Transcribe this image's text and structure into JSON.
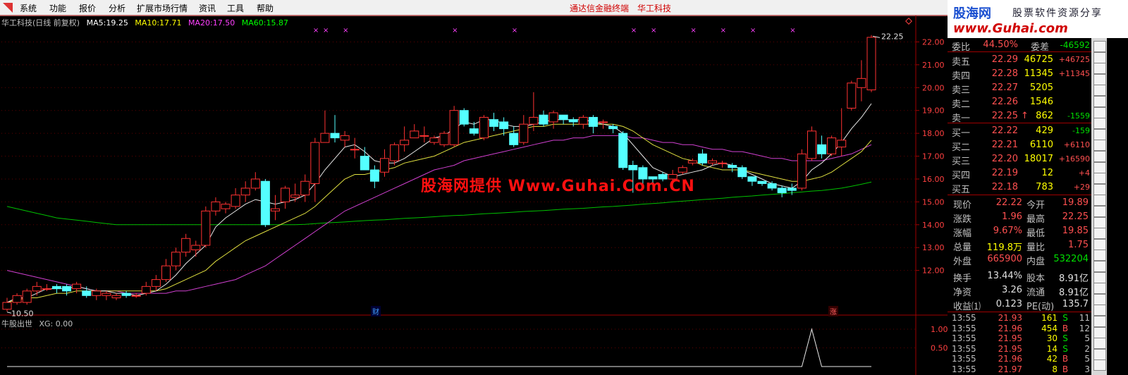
{
  "menu": {
    "items": [
      "系统",
      "功能",
      "报价",
      "分析",
      "扩展市场行情",
      "资讯",
      "工具",
      "帮助"
    ],
    "center_title": [
      "通达信金融终端",
      "华工科技"
    ]
  },
  "legend": {
    "title": "华工科技(日线 前复权)",
    "ma": [
      {
        "label": "MA5:",
        "value": "19.25",
        "color": "#ffffff"
      },
      {
        "label": "MA10:",
        "value": "17.71",
        "color": "#ffff00"
      },
      {
        "label": "MA20:",
        "value": "17.50",
        "color": "#ff40ff"
      },
      {
        "label": "MA60:",
        "value": "15.87",
        "color": "#00ff00"
      }
    ]
  },
  "sub_legend": {
    "name": "牛股出世",
    "xg_label": "XG:",
    "xg_value": "0.00"
  },
  "price_axis": [
    "22.00",
    "21.00",
    "20.00",
    "19.00",
    "18.00",
    "17.00",
    "16.00",
    "15.00",
    "14.00",
    "13.00",
    "12.00"
  ],
  "sub_axis": [
    "1.00",
    "0.50"
  ],
  "annotations": {
    "high_label": "22.25",
    "low_label": "10.50",
    "marker_cai": "财",
    "marker_zhang": "涨"
  },
  "watermark": "股海网提供 Www.Guhai.Com.CN",
  "banner": {
    "brand": "股海网",
    "slogan": "股票软件资源分享",
    "site": "www.Guhai.com"
  },
  "order_book": {
    "ratio_label": "委比",
    "ratio_value": "44.50%",
    "diff_label": "委差",
    "diff_value": "-46592",
    "asks": [
      {
        "label": "卖五",
        "price": "22.29",
        "vol": "46725",
        "chg": "+46725"
      },
      {
        "label": "卖四",
        "price": "22.28",
        "vol": "11345",
        "chg": "+11345"
      },
      {
        "label": "卖三",
        "price": "22.27",
        "vol": "5205",
        "chg": ""
      },
      {
        "label": "卖二",
        "price": "22.26",
        "vol": "1546",
        "chg": ""
      },
      {
        "label": "卖一",
        "price": "22.25",
        "vol": "862",
        "chg": "-1559",
        "arrow": "↑"
      }
    ],
    "bids": [
      {
        "label": "买一",
        "price": "22.22",
        "vol": "429",
        "chg": "-159"
      },
      {
        "label": "买二",
        "price": "22.21",
        "vol": "6110",
        "chg": "+6110"
      },
      {
        "label": "买三",
        "price": "22.20",
        "vol": "18017",
        "chg": "+16590"
      },
      {
        "label": "买四",
        "price": "22.19",
        "vol": "12",
        "chg": "+4"
      },
      {
        "label": "买五",
        "price": "22.18",
        "vol": "783",
        "chg": "+29"
      }
    ]
  },
  "quote": [
    {
      "l1": "现价",
      "v1": "22.22",
      "c1": "red",
      "l2": "今开",
      "v2": "19.89",
      "c2": "red"
    },
    {
      "l1": "涨跌",
      "v1": "1.96",
      "c1": "red",
      "l2": "最高",
      "v2": "22.25",
      "c2": "red"
    },
    {
      "l1": "涨幅",
      "v1": "9.67%",
      "c1": "red",
      "l2": "最低",
      "v2": "19.85",
      "c2": "red"
    },
    {
      "l1": "总量",
      "v1": "119.8万",
      "c1": "yellow",
      "l2": "量比",
      "v2": "1.75",
      "c2": "red"
    },
    {
      "l1": "外盘",
      "v1": "665900",
      "c1": "red",
      "l2": "内盘",
      "v2": "532204",
      "c2": "green"
    },
    {
      "l1": "换手",
      "v1": "13.44%",
      "c1": "white",
      "l2": "股本",
      "v2": "8.91亿",
      "c2": "white"
    },
    {
      "l1": "净资",
      "v1": "3.26",
      "c1": "white",
      "l2": "流通",
      "v2": "8.91亿",
      "c2": "white"
    },
    {
      "l1": "收益⑴",
      "v1": "0.123",
      "c1": "white",
      "l2": "PE(动)",
      "v2": "135.7",
      "c2": "white"
    }
  ],
  "ticks": [
    {
      "time": "13:55",
      "price": "21.93",
      "vol": "161",
      "side": "S",
      "count": "11"
    },
    {
      "time": "13:55",
      "price": "21.96",
      "vol": "454",
      "side": "B",
      "count": "12"
    },
    {
      "time": "13:55",
      "price": "21.95",
      "vol": "30",
      "side": "S",
      "count": "5"
    },
    {
      "time": "13:55",
      "price": "21.95",
      "vol": "14",
      "side": "S",
      "count": "2"
    },
    {
      "time": "13:55",
      "price": "21.96",
      "vol": "42",
      "side": "B",
      "count": "5"
    },
    {
      "time": "13:55",
      "price": "21.97",
      "vol": "8",
      "side": "B",
      "count": "3"
    }
  ],
  "chart_data": {
    "type": "candlestick",
    "ylim": [
      10.2,
      22.6
    ],
    "candles": [
      [
        10.3,
        10.6,
        10.2,
        10.8
      ],
      [
        10.6,
        10.9,
        10.5,
        11.0
      ],
      [
        10.6,
        11.1,
        10.5,
        11.2
      ],
      [
        11.1,
        11.3,
        10.9,
        11.5
      ],
      [
        11.2,
        11.2,
        11.1,
        11.4
      ],
      [
        11.3,
        11.2,
        11.0,
        11.4
      ],
      [
        11.3,
        11.1,
        10.9,
        11.4
      ],
      [
        11.2,
        11.4,
        11.0,
        11.5
      ],
      [
        11.1,
        10.9,
        10.8,
        11.3
      ],
      [
        10.9,
        11.1,
        10.7,
        11.2
      ],
      [
        10.9,
        11.0,
        10.7,
        11.1
      ],
      [
        10.8,
        10.9,
        10.7,
        11.0
      ],
      [
        11.0,
        10.9,
        10.8,
        11.1
      ],
      [
        10.9,
        10.9,
        10.8,
        11.0
      ],
      [
        11.0,
        11.3,
        10.9,
        11.5
      ],
      [
        11.3,
        11.6,
        11.1,
        11.8
      ],
      [
        11.6,
        12.2,
        11.5,
        12.5
      ],
      [
        12.2,
        12.8,
        12.0,
        13.0
      ],
      [
        12.8,
        13.4,
        12.6,
        13.6
      ],
      [
        12.9,
        13.1,
        12.6,
        13.3
      ],
      [
        13.1,
        14.6,
        13.0,
        14.8
      ],
      [
        14.6,
        15.0,
        14.4,
        15.2
      ],
      [
        14.7,
        14.9,
        14.5,
        15.0
      ],
      [
        14.8,
        15.3,
        14.7,
        15.6
      ],
      [
        15.3,
        15.6,
        15.0,
        15.9
      ],
      [
        15.6,
        16.0,
        15.5,
        16.3
      ],
      [
        15.9,
        14.0,
        13.9,
        16.0
      ],
      [
        14.6,
        14.7,
        14.2,
        15.3
      ],
      [
        15.0,
        15.6,
        14.7,
        15.7
      ],
      [
        15.2,
        15.3,
        15.0,
        15.8
      ],
      [
        15.3,
        15.9,
        15.0,
        16.2
      ],
      [
        15.8,
        17.6,
        15.0,
        17.8
      ],
      [
        17.6,
        18.0,
        17.6,
        19.0
      ],
      [
        18.0,
        17.8,
        17.6,
        18.8
      ],
      [
        17.7,
        17.9,
        17.4,
        18.1
      ],
      [
        17.3,
        17.3,
        16.9,
        17.8
      ],
      [
        17.0,
        16.4,
        16.4,
        17.4
      ],
      [
        16.4,
        15.9,
        15.6,
        16.6
      ],
      [
        16.3,
        16.9,
        16.1,
        17.3
      ],
      [
        16.8,
        17.5,
        16.6,
        17.6
      ],
      [
        17.5,
        17.7,
        17.2,
        18.3
      ],
      [
        17.8,
        18.1,
        17.8,
        18.4
      ],
      [
        17.9,
        17.9,
        17.6,
        18.3
      ],
      [
        17.6,
        17.8,
        17.5,
        17.9
      ],
      [
        17.5,
        18.0,
        17.4,
        18.1
      ],
      [
        17.5,
        19.0,
        17.4,
        19.2
      ],
      [
        19.0,
        18.4,
        18.3,
        19.1
      ],
      [
        18.2,
        18.0,
        17.9,
        18.5
      ],
      [
        17.8,
        18.7,
        17.7,
        18.8
      ],
      [
        18.6,
        18.3,
        18.1,
        18.9
      ],
      [
        18.5,
        18.2,
        17.9,
        18.7
      ],
      [
        18.0,
        17.5,
        17.4,
        18.3
      ],
      [
        17.6,
        18.4,
        17.5,
        18.8
      ],
      [
        18.4,
        18.7,
        18.1,
        19.8
      ],
      [
        18.8,
        18.4,
        18.3,
        19.0
      ],
      [
        18.5,
        18.9,
        18.2,
        19.0
      ],
      [
        18.8,
        18.6,
        18.4,
        18.8
      ],
      [
        18.6,
        18.5,
        18.3,
        18.7
      ],
      [
        18.4,
        18.7,
        18.2,
        18.8
      ],
      [
        18.7,
        18.3,
        18.0,
        18.8
      ],
      [
        18.5,
        18.5,
        18.2,
        18.6
      ],
      [
        18.3,
        18.2,
        18.0,
        18.4
      ],
      [
        18.0,
        16.5,
        16.4,
        18.1
      ],
      [
        16.6,
        16.4,
        15.4,
        16.8
      ],
      [
        16.5,
        16.0,
        15.6,
        16.6
      ],
      [
        16.1,
        16.0,
        15.8,
        16.1
      ],
      [
        16.2,
        16.0,
        15.9,
        16.3
      ],
      [
        16.0,
        16.2,
        15.8,
        16.4
      ],
      [
        16.3,
        16.5,
        16.2,
        16.6
      ],
      [
        16.7,
        16.8,
        16.6,
        16.9
      ],
      [
        17.1,
        16.7,
        16.6,
        17.3
      ],
      [
        16.7,
        16.8,
        16.6,
        16.9
      ],
      [
        16.7,
        16.7,
        16.5,
        16.8
      ],
      [
        16.6,
        16.5,
        16.3,
        16.7
      ],
      [
        16.5,
        16.1,
        16.0,
        16.6
      ],
      [
        16.1,
        15.9,
        15.7,
        16.1
      ],
      [
        15.9,
        15.8,
        15.7,
        15.9
      ],
      [
        15.8,
        15.6,
        15.5,
        15.9
      ],
      [
        15.6,
        15.4,
        15.2,
        15.7
      ],
      [
        15.6,
        15.5,
        15.3,
        15.8
      ],
      [
        15.6,
        17.1,
        15.5,
        17.3
      ],
      [
        16.9,
        18.1,
        16.8,
        18.3
      ],
      [
        17.5,
        17.1,
        16.9,
        17.9
      ],
      [
        17.1,
        17.8,
        17.0,
        17.9
      ],
      [
        17.4,
        17.7,
        17.0,
        19.1
      ],
      [
        19.1,
        20.2,
        19.0,
        20.3
      ],
      [
        20.0,
        20.4,
        19.4,
        21.2
      ],
      [
        19.9,
        22.2,
        19.8,
        22.3
      ]
    ],
    "ma5": [
      10.6,
      10.8,
      10.8,
      11.0,
      11.2,
      11.2,
      11.2,
      11.3,
      11.2,
      11.1,
      11.1,
      11.0,
      11.0,
      10.9,
      11.0,
      11.1,
      11.4,
      11.8,
      12.3,
      12.7,
      13.1,
      13.9,
      14.3,
      14.6,
      14.9,
      15.1,
      15.0,
      14.9,
      15.0,
      15.1,
      15.3,
      15.8,
      16.4,
      16.9,
      17.4,
      17.5,
      17.2,
      16.8,
      16.7,
      16.7,
      16.9,
      17.2,
      17.5,
      17.8,
      17.9,
      18.2,
      18.5,
      18.4,
      18.6,
      18.6,
      18.4,
      18.3,
      18.3,
      18.4,
      18.5,
      18.6,
      18.6,
      18.6,
      18.6,
      18.5,
      18.4,
      18.3,
      18.0,
      17.5,
      17.0,
      16.5,
      16.3,
      16.1,
      16.2,
      16.3,
      16.4,
      16.6,
      16.7,
      16.6,
      16.4,
      16.2,
      16.0,
      15.8,
      15.7,
      15.6,
      15.9,
      16.4,
      16.7,
      17.1,
      17.6,
      18.2,
      18.7,
      19.3
    ],
    "ma10": [
      10.6,
      10.7,
      10.8,
      10.8,
      10.9,
      11.0,
      11.0,
      11.1,
      11.1,
      11.1,
      11.1,
      11.1,
      11.1,
      11.1,
      11.1,
      11.1,
      11.2,
      11.4,
      11.6,
      11.8,
      12.0,
      12.4,
      12.7,
      13.0,
      13.3,
      13.5,
      13.7,
      13.9,
      14.1,
      14.3,
      14.5,
      14.8,
      15.2,
      15.6,
      16.0,
      16.2,
      16.2,
      16.3,
      16.4,
      16.5,
      16.7,
      16.8,
      16.9,
      17.0,
      17.2,
      17.4,
      17.6,
      17.7,
      17.8,
      17.9,
      18.0,
      18.1,
      18.2,
      18.3,
      18.3,
      18.4,
      18.4,
      18.4,
      18.4,
      18.4,
      18.4,
      18.4,
      18.3,
      18.1,
      17.8,
      17.5,
      17.3,
      17.1,
      16.9,
      16.8,
      16.6,
      16.5,
      16.4,
      16.4,
      16.4,
      16.3,
      16.2,
      16.1,
      16.0,
      15.9,
      15.9,
      16.0,
      16.1,
      16.3,
      16.6,
      16.9,
      17.2,
      17.7
    ],
    "ma20": [
      12.0,
      11.9,
      11.8,
      11.7,
      11.6,
      11.5,
      11.4,
      11.3,
      11.2,
      11.1,
      11.1,
      11.1,
      11.0,
      11.0,
      11.0,
      11.0,
      11.0,
      11.1,
      11.1,
      11.2,
      11.3,
      11.4,
      11.5,
      11.6,
      11.8,
      12.0,
      12.2,
      12.5,
      12.8,
      13.1,
      13.4,
      13.7,
      14.0,
      14.3,
      14.6,
      14.8,
      15.0,
      15.2,
      15.4,
      15.6,
      15.8,
      16.0,
      16.2,
      16.4,
      16.5,
      16.6,
      16.8,
      16.9,
      17.0,
      17.1,
      17.2,
      17.3,
      17.4,
      17.5,
      17.6,
      17.7,
      17.7,
      17.8,
      17.8,
      17.9,
      17.9,
      17.9,
      17.9,
      17.8,
      17.8,
      17.7,
      17.6,
      17.6,
      17.5,
      17.5,
      17.4,
      17.3,
      17.3,
      17.2,
      17.2,
      17.1,
      17.0,
      16.9,
      16.9,
      16.8,
      16.8,
      16.8,
      16.8,
      16.9,
      17.0,
      17.1,
      17.3,
      17.5
    ],
    "ma60": [
      14.8,
      14.7,
      14.6,
      14.5,
      14.4,
      14.3,
      14.25,
      14.2,
      14.15,
      14.1,
      14.05,
      14.0,
      14.0,
      14.0,
      14.0,
      14.0,
      14.0,
      14.0,
      14.0,
      14.0,
      14.0,
      14.0,
      14.0,
      14.0,
      14.0,
      14.0,
      14.0,
      14.0,
      14.0,
      14.0,
      14.02,
      14.05,
      14.08,
      14.1,
      14.12,
      14.15,
      14.18,
      14.2,
      14.22,
      14.25,
      14.28,
      14.3,
      14.32,
      14.35,
      14.38,
      14.4,
      14.42,
      14.45,
      14.48,
      14.5,
      14.52,
      14.55,
      14.58,
      14.6,
      14.62,
      14.65,
      14.68,
      14.7,
      14.72,
      14.75,
      14.78,
      14.8,
      14.83,
      14.86,
      14.9,
      14.93,
      14.96,
      15.0,
      15.03,
      15.06,
      15.1,
      15.13,
      15.16,
      15.2,
      15.23,
      15.26,
      15.3,
      15.33,
      15.36,
      15.4,
      15.43,
      15.47,
      15.5,
      15.55,
      15.6,
      15.68,
      15.77,
      15.87
    ],
    "xg": [
      0,
      0,
      0,
      0,
      0,
      0,
      0,
      0,
      0,
      0,
      0,
      0,
      0,
      0,
      0,
      0,
      0,
      0,
      0,
      0,
      0,
      0,
      0,
      0,
      0,
      0,
      0,
      0,
      0,
      0,
      0,
      0,
      0,
      0,
      0,
      0,
      0,
      0,
      0,
      0,
      0,
      0,
      0,
      0,
      0,
      0,
      0,
      0,
      0,
      0,
      0,
      0,
      0,
      0,
      0,
      0,
      0,
      0,
      0,
      0,
      0,
      0,
      0,
      0,
      0,
      0,
      0,
      0,
      0,
      0,
      0,
      0,
      0,
      0,
      0,
      0,
      0,
      0,
      0,
      0,
      0,
      0,
      0,
      0,
      0,
      0,
      0,
      0
    ],
    "xg_spike": {
      "index": 81,
      "value": 1.0
    },
    "x_markers": [
      31,
      32,
      34,
      45,
      51,
      63,
      65,
      69,
      72,
      75,
      79
    ]
  }
}
